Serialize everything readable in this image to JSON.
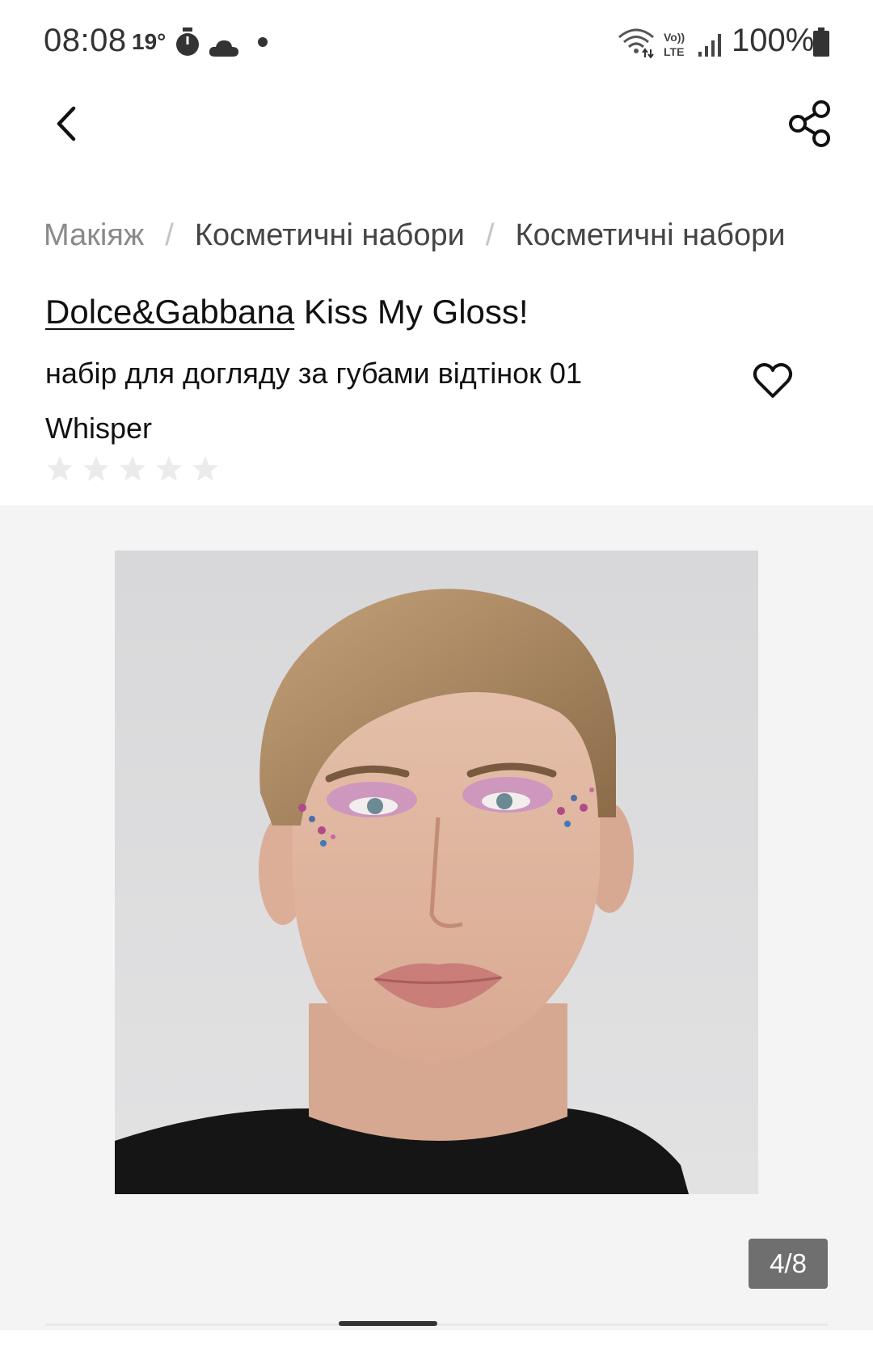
{
  "status_bar": {
    "time": "08:08",
    "temperature": "19°",
    "battery": "100%",
    "icons": [
      "timer-icon",
      "cloud-icon",
      "notification-dot-icon",
      "wifi-icon",
      "volte-icon",
      "signal-icon",
      "battery-icon"
    ]
  },
  "app_bar": {
    "back_icon": "chevron-left-icon",
    "share_icon": "share-icon"
  },
  "breadcrumb": {
    "items": [
      "Макіяж",
      "Косметичні набори",
      "Косметичні набори"
    ],
    "separator": "/"
  },
  "product": {
    "brand": "Dolce&Gabbana",
    "name": "Kiss My Gloss!",
    "subtitle": "набір для догляду за губами відтінок 01 Whisper",
    "rating": 0,
    "rating_max": 5,
    "favorite_icon": "heart-outline-icon"
  },
  "gallery": {
    "counter": "4/8",
    "current_index": 4,
    "total": 8
  },
  "colors": {
    "text_primary": "#111111",
    "breadcrumb_muted": "#8a8a8a",
    "star_empty": "#ebebeb",
    "gallery_bg": "#f4f4f4",
    "counter_bg": "#6f6f6f"
  }
}
